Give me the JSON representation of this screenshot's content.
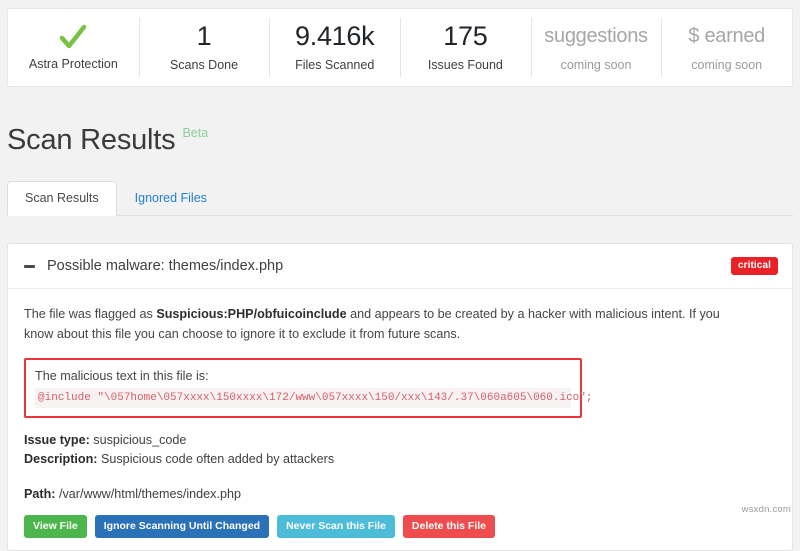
{
  "stats": [
    {
      "icon": "check-icon",
      "value": "",
      "label": "Astra Protection",
      "muted": false
    },
    {
      "icon": "",
      "value": "1",
      "label": "Scans Done",
      "muted": false
    },
    {
      "icon": "",
      "value": "9.416k",
      "label": "Files Scanned",
      "muted": false
    },
    {
      "icon": "",
      "value": "175",
      "label": "Issues Found",
      "muted": false
    },
    {
      "icon": "",
      "value": "suggestions",
      "label": "coming soon",
      "muted": true
    },
    {
      "icon": "",
      "value": "$ earned",
      "label": "coming soon",
      "muted": true
    }
  ],
  "page": {
    "title": "Scan Results",
    "beta_label": "Beta"
  },
  "tabs": [
    {
      "label": "Scan Results",
      "active": true
    },
    {
      "label": "Ignored Files",
      "active": false
    }
  ],
  "result": {
    "title": "Possible malware: themes/index.php",
    "severity_badge": "critical",
    "description_prefix": "The file was flagged as ",
    "description_signature": "Suspicious:PHP/obfuicoinclude",
    "description_suffix": " and appears to be created by a hacker with malicious intent. If you know about this file you can choose to ignore it to exclude it from future scans.",
    "malicious_label": "The malicious text in this file is:",
    "malicious_code": "@include \"\\057home\\057xxxx\\150xxxx\\172/www\\057xxxx\\150/xxx\\143/.37\\060a605\\060.ico\";",
    "issue_type_label": "Issue type:",
    "issue_type_value": "suspicious_code",
    "description_label": "Description:",
    "description_value": "Suspicious code often added by attackers",
    "path_label": "Path:",
    "path_value": "/var/www/html/themes/index.php",
    "buttons": [
      {
        "label": "View File",
        "style": "btn-view"
      },
      {
        "label": "Ignore Scanning Until Changed",
        "style": "btn-ignore"
      },
      {
        "label": "Never Scan this File",
        "style": "btn-never"
      },
      {
        "label": "Delete this File",
        "style": "btn-delete"
      }
    ]
  },
  "watermark": "wsxdn.com",
  "colors": {
    "critical": "#ea2127",
    "beta": "#8fce9a",
    "check": "#7ac143",
    "link": "#1f7fd0",
    "malicious_border": "#e8383d",
    "malicious_code": "#d5606a"
  }
}
